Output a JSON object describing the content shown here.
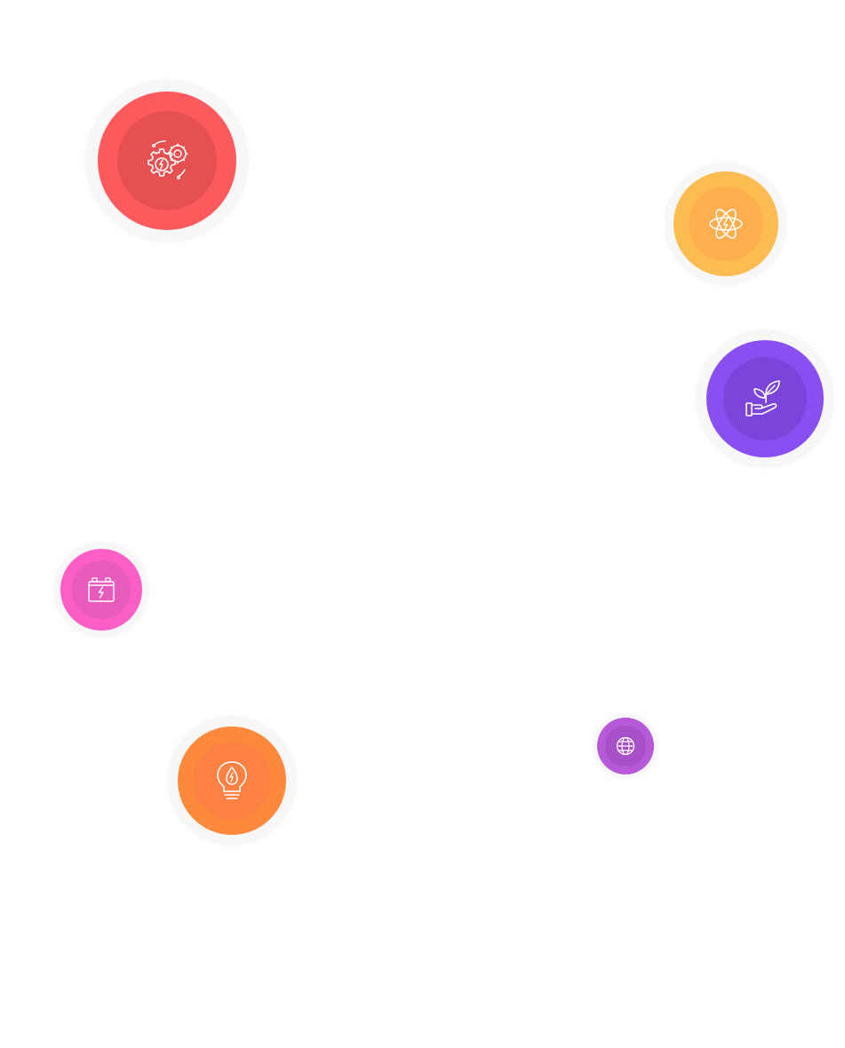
{
  "bubbles": [
    {
      "id": "b-gears",
      "icon": "gears-bolt-icon",
      "outer_color": "#fd5a5d",
      "inner_color": "#e65050"
    },
    {
      "id": "b-atom",
      "icon": "atom-bolt-icon",
      "outer_color": "#fdbc51",
      "inner_color": "#fdae4f"
    },
    {
      "id": "b-plant",
      "icon": "hand-plant-icon",
      "outer_color": "#8a4ff0",
      "inner_color": "#7b45dc"
    },
    {
      "id": "b-battery",
      "icon": "battery-bolt-icon",
      "outer_color": "#fb5fc6",
      "inner_color": "#e75cba"
    },
    {
      "id": "b-bulb",
      "icon": "eco-lightbulb-icon",
      "outer_color": "#fd8a3c",
      "inner_color": "#fc8143"
    },
    {
      "id": "b-globe",
      "icon": "globe-icon",
      "outer_color": "#b85ad8",
      "inner_color": "#a750c8"
    }
  ]
}
